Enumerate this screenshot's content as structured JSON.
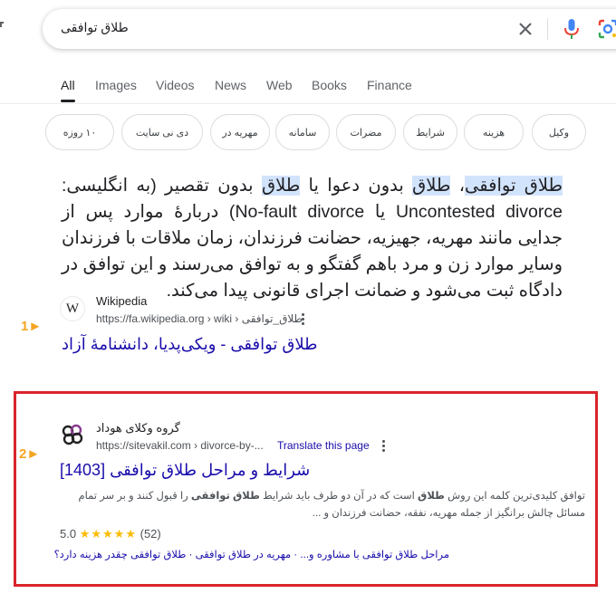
{
  "search": {
    "query": "طلاق توافقی"
  },
  "tabs": [
    {
      "label": "All"
    },
    {
      "label": "Images"
    },
    {
      "label": "Videos"
    },
    {
      "label": "News"
    },
    {
      "label": "Web"
    },
    {
      "label": "Books"
    },
    {
      "label": "Finance"
    }
  ],
  "chips": [
    "۱۰ روزه",
    "دی نی سایت",
    "مهریه در",
    "سامانه",
    "مضرات",
    "شرایط",
    "هزینه",
    "وکیل"
  ],
  "snippet": {
    "parts": [
      "طلاق توافقی",
      "، ",
      "طلاق",
      " بدون دعوا یا ",
      "طلاق",
      " بدون تقصیر (به انگلیسی: Uncontested divorce یا No-fault divorce) دربارهٔ موارد پس از جدایی مانند مهریه، جهیزیه، حضانت فرزندان، زمان ملاقات با فرزندان وسایر موارد زن و مرد باهم گفتگو و به توافق می‌رسند و این توافق در دادگاه ثبت می‌شود و ضمانت اجرای قانونی پیدا می‌کند."
    ]
  },
  "result1": {
    "site_name": "Wikipedia",
    "url": "https://fa.wikipedia.org › wiki › طلاق_توافقی",
    "title": "طلاق توافقی - ویکی‌پدیا، دانشنامهٔ آزاد",
    "marker": "1►",
    "favicon_letter": "W"
  },
  "result2": {
    "site_name": "گروه وکلای هوداد",
    "url": "https://sitevakil.com › divorce-by-...",
    "translate": "Translate this page",
    "title": "شرایط و مراحل طلاق توافقی [1403]",
    "marker": "2►",
    "desc_parts": [
      "توافق کلیدی‌ترین کلمه این روش ",
      "طلاق",
      " است که در آن دو طرف باید شرایط ",
      "طلاق توافقی",
      " را قبول کنند و بر سر تمام مسائل چالش برانگیز از جمله مهریه، نفقه، حضانت فرزندان و ..."
    ],
    "rating": "5.0",
    "stars": "★★★★★",
    "rating_count": "(52)",
    "sitelinks": "مراحل طلاق توافقی با مشاوره و... · مهریه در طلاق توافقی · طلاق توافقی چقدر هزینه دارد؟"
  },
  "colors": {
    "link": "#1a0dab",
    "highlight": "#d2e3fc",
    "annotation_box": "#d9252b",
    "annotation_arrow": "#f4a522"
  }
}
